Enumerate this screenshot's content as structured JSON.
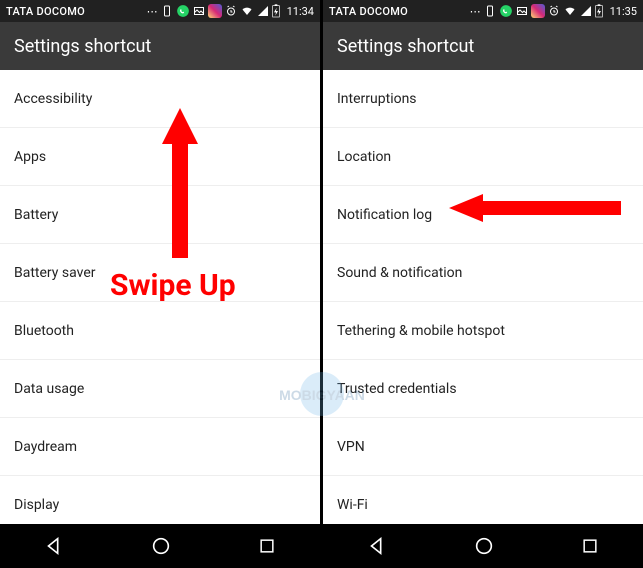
{
  "phones": [
    {
      "status": {
        "carrier": "TATA DOCOMO",
        "time": "11:34"
      },
      "title": "Settings shortcut",
      "items": [
        "Accessibility",
        "Apps",
        "Battery",
        "Battery saver",
        "Bluetooth",
        "Data usage",
        "Daydream",
        "Display"
      ],
      "annotation": {
        "text": "Swipe Up"
      }
    },
    {
      "status": {
        "carrier": "TATA DOCOMO",
        "time": "11:35"
      },
      "title": "Settings shortcut",
      "items": [
        "Interruptions",
        "Location",
        "Notification log",
        "Sound & notification",
        "Tethering & mobile hotspot",
        "Trusted credentials",
        "VPN",
        "Wi-Fi"
      ]
    }
  ],
  "watermark": "MOBIGYAAN"
}
